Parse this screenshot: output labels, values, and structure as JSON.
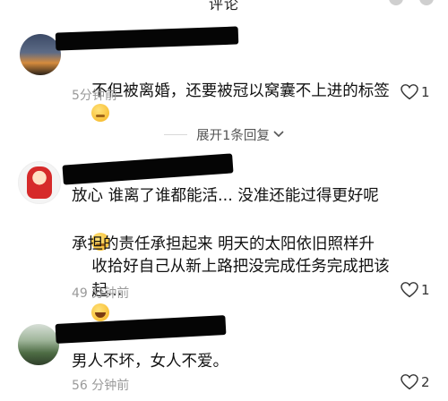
{
  "header": {
    "title": "评论"
  },
  "comments": [
    {
      "text": "不但被离婚，还要被冠以窝囊不上进的标签",
      "time": "5分钟前",
      "likes": "1"
    },
    {
      "line1": "放心 谁离了谁都能活... 没准还能过得更好呢",
      "line2": "收拾好自己从新上路把没完成任务完成把该",
      "line3": "承担的责任承担起来 明天的太阳依旧照样升",
      "line4": "起...",
      "time": "49 分钟前",
      "likes": "1"
    },
    {
      "text": "男人不坏，女人不爱。",
      "time": "56 分钟前",
      "likes": "2"
    }
  ],
  "expand": {
    "label": "展开1条回复"
  },
  "colors": {
    "text": "#1a1a1a",
    "muted": "#9a9a9a",
    "redaction": "#050505"
  }
}
